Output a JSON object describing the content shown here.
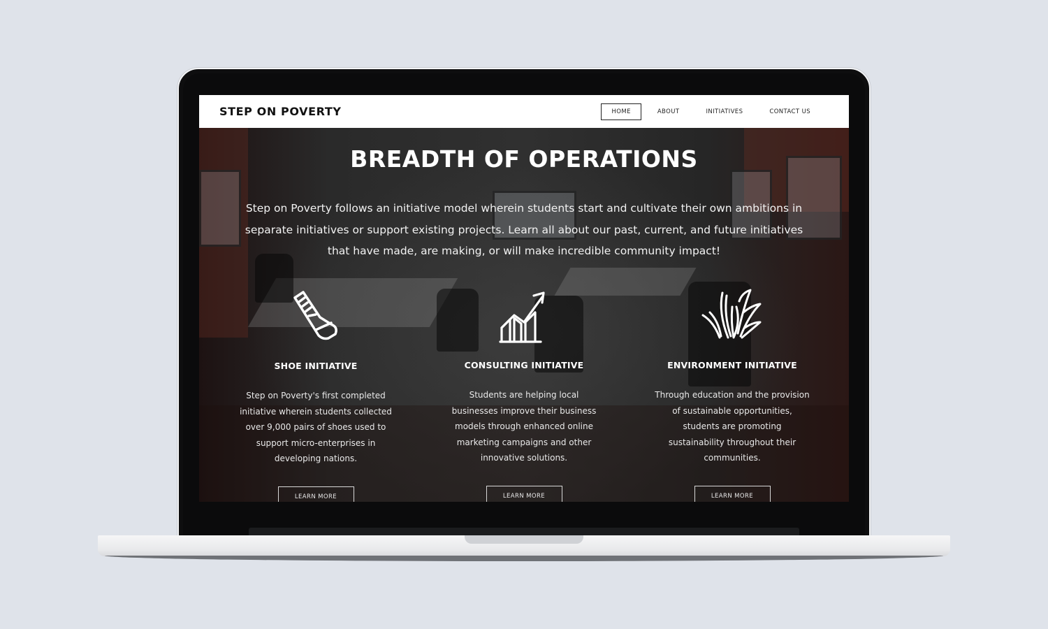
{
  "site": {
    "brand": "STEP ON POVERTY",
    "nav": [
      {
        "label": "HOME",
        "active": true
      },
      {
        "label": "ABOUT",
        "active": false
      },
      {
        "label": "INITIATIVES",
        "active": false
      },
      {
        "label": "CONTACT US",
        "active": false
      }
    ]
  },
  "hero": {
    "title": "BREADTH OF OPERATIONS",
    "text": "Step on Poverty follows an initiative model wherein students start and cultivate their own ambitions in separate initiatives or support existing projects. Learn all about our past, current, and future initiatives that have made, are making, or will make incredible community impact!"
  },
  "initiatives": [
    {
      "icon": "shoe-icon",
      "title": "SHOE INITIATIVE",
      "text": "Step on Poverty's first completed initiative wherein students collected over 9,000 pairs of shoes used to support micro-enterprises in developing nations.",
      "button": "LEARN MORE"
    },
    {
      "icon": "growth-chart-icon",
      "title": "CONSULTING INITIATIVE",
      "text": "Students are helping local businesses improve their business models through enhanced online marketing campaigns and other innovative solutions.",
      "button": "LEARN MORE"
    },
    {
      "icon": "plant-leaves-icon",
      "title": "ENVIRONMENT INITIATIVE",
      "text": "Through education and the provision of sustainable opportunities, students are promoting sustainability throughout their communities.",
      "button": "LEARN MORE"
    }
  ],
  "colors": {
    "page_background": "#dfe3ea",
    "laptop_frame": "#0e0e0f",
    "header_background": "#ffffff",
    "hero_text": "#ffffff"
  }
}
